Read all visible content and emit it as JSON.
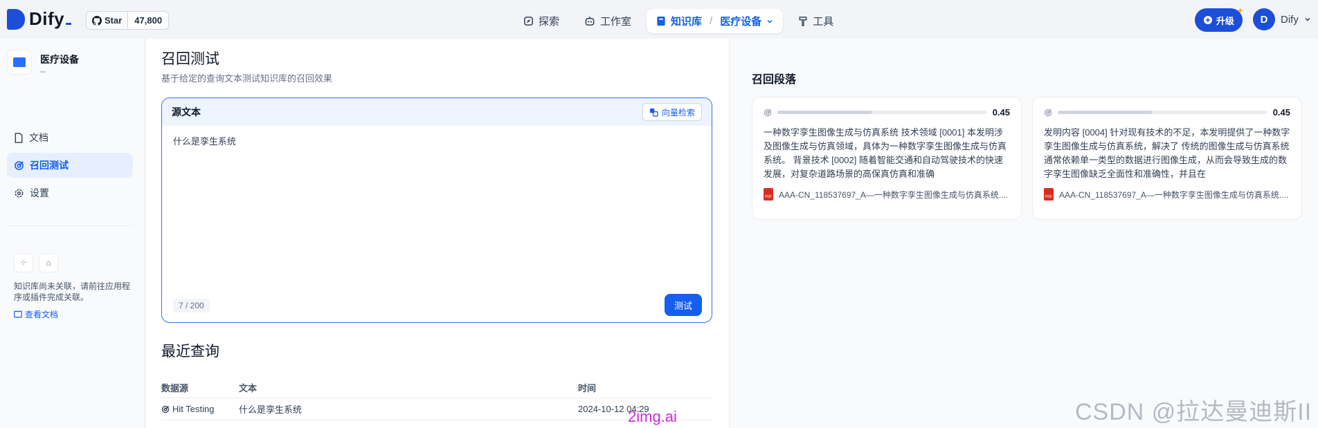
{
  "header": {
    "logo_text": "Dify",
    "github": {
      "label": "Star",
      "count": "47,800"
    },
    "nav": {
      "explore": "探索",
      "studio": "工作室",
      "knowledge": "知识库",
      "separator": "/",
      "current_dataset": "医疗设备",
      "tools": "工具"
    },
    "upgrade_label": "升级",
    "user": {
      "initial": "D",
      "name": "Dify"
    }
  },
  "sidebar": {
    "dataset_name": "医疗设备",
    "dataset_desc": "--",
    "items": [
      {
        "label": "文档"
      },
      {
        "label": "召回测试"
      },
      {
        "label": "设置"
      }
    ],
    "tip_text": "知识库尚未关联，请前往应用程序或插件完成关联。",
    "tip_link": "查看文档"
  },
  "main": {
    "title": "召回测试",
    "subtitle": "基于给定的查询文本测试知识库的召回效果",
    "query_box": {
      "label": "源文本",
      "method_button": "向量检索",
      "text": "什么是孪生系统",
      "count": "7 / 200",
      "run_button": "测试"
    },
    "recent": {
      "title": "最近查询",
      "columns": [
        "数据源",
        "文本",
        "时间"
      ],
      "rows": [
        {
          "source": "Hit Testing",
          "text": "什么是孪生系统",
          "time": "2024-10-12 04:29"
        }
      ]
    }
  },
  "results": {
    "title": "召回段落",
    "cards": [
      {
        "score": "0.45",
        "score_value": 0.45,
        "content": "一种数字孪生图像生成与仿真系统 技术领域 [0001] 本发明涉及图像生成与仿真领域，具体为一种数字孪生图像生成与仿真系统。 背景技术 [0002] 随着智能交通和自动驾驶技术的快速发展，对复杂道路场景的高保真仿真和准确",
        "doc": "AAA-CN_118537697_A—一种数字孪生图像生成与仿真系统...."
      },
      {
        "score": "0.45",
        "score_value": 0.45,
        "content": "发明内容 [0004] 针对现有技术的不足，本发明提供了一种数字孪生图像生成与仿真系统，解决了 传统的图像生成与仿真系统通常依赖单一类型的数据进行图像生成，从而会导致生成的数 字孪生图像缺乏全面性和准确性，并且在",
        "doc": "AAA-CN_118537697_A—一种数字孪生图像生成与仿真系统...."
      }
    ]
  },
  "watermarks": {
    "csdn": "CSDN @拉达曼迪斯II",
    "site": "2img.ai"
  },
  "colors": {
    "accent": "#155eef",
    "brand": "#1c4ed8",
    "pdf": "#d92d20"
  }
}
